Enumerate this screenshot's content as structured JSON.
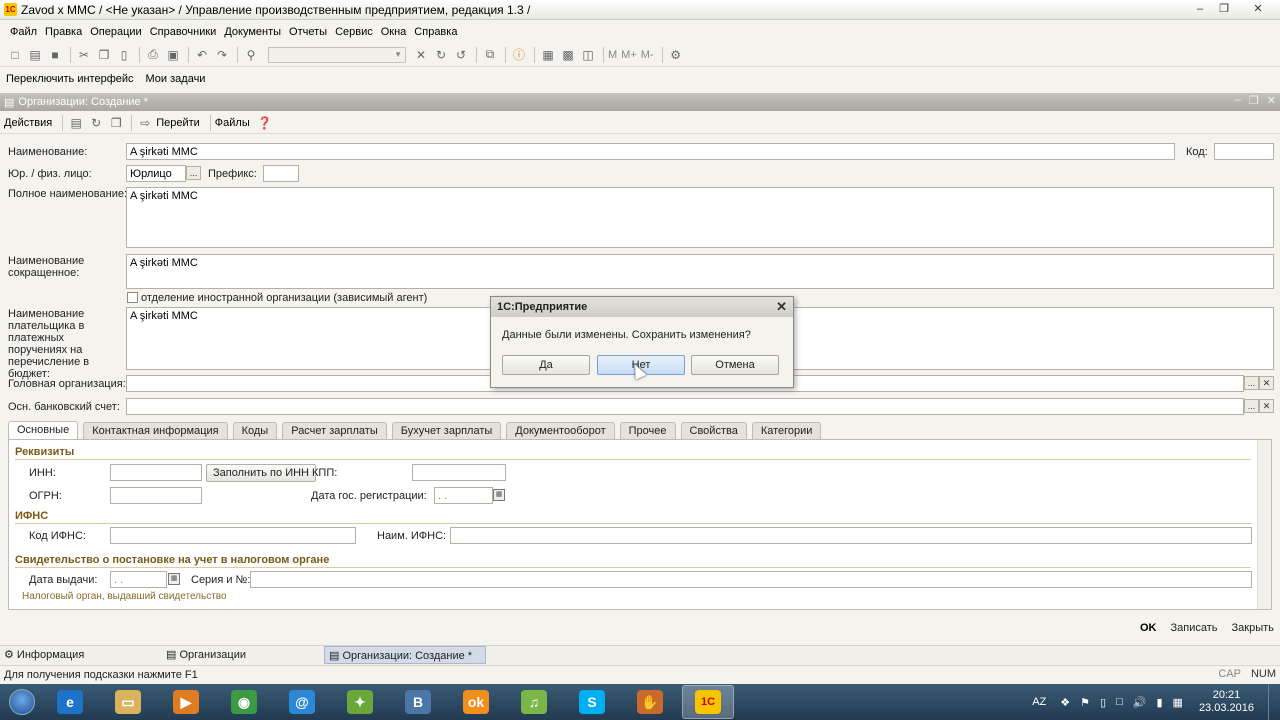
{
  "window": {
    "title": "Zavod x MMC / <Не указан> / Управление производственным предприятием, редакция 1.3 /"
  },
  "menu": [
    "Файл",
    "Правка",
    "Операции",
    "Справочники",
    "Документы",
    "Отчеты",
    "Сервис",
    "Окна",
    "Справка"
  ],
  "toolbar2": {
    "switch_interface": "Переключить интерфейс",
    "my_tasks": "Мои задачи"
  },
  "toolbar1": {
    "m": "M",
    "m_plus": "M+",
    "m_minus": "M-"
  },
  "form": {
    "title": "Организации: Создание *",
    "toolbar": {
      "actions": "Действия",
      "goto": "Перейти",
      "files": "Файлы"
    },
    "name_label": "Наименование:",
    "name_value": "A şirkəti MMC",
    "code_label": "Код:",
    "code_value": "",
    "legal_label": "Юр. / физ. лицо:",
    "legal_value": "Юрлицо",
    "prefix_label": "Префикс:",
    "prefix_value": "",
    "full_name_label": "Полное наименование:",
    "full_name_value": "A şirkəti MMC",
    "short_name_label": "Наименование сокращенное:",
    "short_name_value": "A şirkəti MMC",
    "foreign_branch_label": "отделение иностранной организации (зависимый агент)",
    "payer_name_label": "Наименование плательщика в платежных поручениях на перечисление в бюджет:",
    "payer_name_value": "A şirkəti MMC",
    "head_org_label": "Головная организация:",
    "bank_account_label": "Осн. банковский счет:",
    "tabs": [
      "Основные",
      "Контактная информация",
      "Коды",
      "Расчет зарплаты",
      "Бухучет зарплаты",
      "Документооборот",
      "Прочее",
      "Свойства",
      "Категории"
    ],
    "active_tab": "Основные",
    "main_tab": {
      "requisites_header": "Реквизиты",
      "inn_label": "ИНН:",
      "fill_by_inn_button": "Заполнить по ИНН",
      "kpp_label": "КПП:",
      "ogrn_label": "ОГРН:",
      "reg_date_label": "Дата гос. регистрации:",
      "reg_date_value": " .  .",
      "ifns_header": "ИФНС",
      "ifns_code_label": "Код ИФНС:",
      "ifns_name_label": "Наим. ИФНС:",
      "cert_header": "Свидетельство о постановке на учет в налоговом органе",
      "issue_date_label": "Дата выдачи:",
      "issue_date_value": " .  .",
      "series_label": "Серия и №:",
      "tax_authority_label": "Налоговый орган, выдавший свидетельство"
    },
    "bottom_actions": {
      "ok": "OK",
      "save": "Записать",
      "close": "Закрыть"
    }
  },
  "dialog": {
    "title": "1С:Предприятие",
    "message": "Данные были изменены. Сохранить изменения?",
    "yes": "Да",
    "no": "Нет",
    "cancel": "Отмена"
  },
  "window_tabs": [
    "Информация",
    "Организации",
    "Организации: Создание *"
  ],
  "status": {
    "hint": "Для получения подсказки нажмите F1",
    "caps": "CAP",
    "num": "NUM"
  },
  "taskbar": {
    "apps": [
      {
        "icon": "ie-icon",
        "color": "#1e73c9"
      },
      {
        "icon": "explorer-icon",
        "color": "#d9b25a"
      },
      {
        "icon": "media-player-icon",
        "color": "#e07b24"
      },
      {
        "icon": "chrome-icon",
        "color": "#3b9a44"
      },
      {
        "icon": "mail-agent-icon",
        "color": "#2b88d8"
      },
      {
        "icon": "green-app-icon",
        "color": "#6aa83a"
      },
      {
        "icon": "vk-icon",
        "color": "#4a76a8"
      },
      {
        "icon": "odnoklassniki-icon",
        "color": "#f28e1c"
      },
      {
        "icon": "music-icon",
        "color": "#7ab648"
      },
      {
        "icon": "skype-icon",
        "color": "#00aff0"
      },
      {
        "icon": "hand-app-icon",
        "color": "#c96a2a"
      },
      {
        "icon": "1c-icon",
        "color": "#f6c500"
      }
    ],
    "language": "AZ",
    "time": "20:21",
    "date": "23.03.2016"
  }
}
